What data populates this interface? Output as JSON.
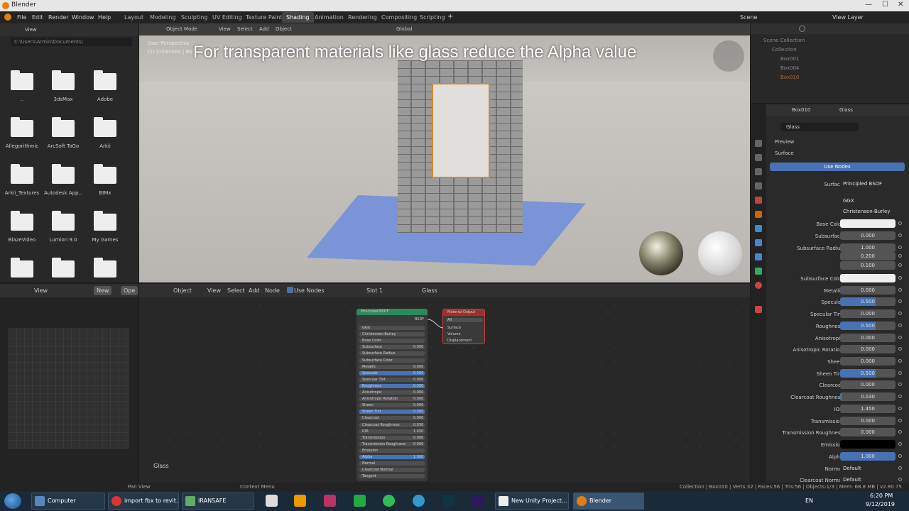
{
  "window": {
    "title": "Blender",
    "min": "—",
    "max": "☐",
    "close": "✕"
  },
  "menu": {
    "items": [
      "File",
      "Edit",
      "Render",
      "Window",
      "Help"
    ]
  },
  "workspaces": [
    "Layout",
    "Modeling",
    "Sculpting",
    "UV Editing",
    "Texture Paint",
    "Shading",
    "Animation",
    "Rendering",
    "Compositing",
    "Scripting"
  ],
  "scene": {
    "scene_label": "Scene",
    "view_layer": "View Layer"
  },
  "filebrowser": {
    "view": "View",
    "path": "C:\\Users\\Armin\\Documents\\",
    "items": [
      "..",
      "3dsMax",
      "Adobe",
      "Allegorithmic",
      "ArcSoft ToGo",
      "Arkii",
      "Arkii_Textures",
      "Autodesk App...",
      "BIMx",
      "BlazeVideo",
      "Lumion 9.0",
      "My Games",
      "",
      "",
      ""
    ]
  },
  "viewport": {
    "mode": "Object Mode",
    "view": "View",
    "select": "Select",
    "add": "Add",
    "object": "Object",
    "orientation": "Global",
    "perspective": "User Perspective",
    "collection": "(1) Collection | Bo",
    "overlay_text": "For transparent materials like glass reduce the Alpha value"
  },
  "node_editor": {
    "object": "Object",
    "view": "View",
    "select": "Select",
    "add": "Add",
    "node": "Node",
    "use_nodes": "Use Nodes",
    "slot": "Slot 1",
    "material": "Glass",
    "new": "New",
    "open": "Ope",
    "footer": "Glass",
    "principled": {
      "title": "Principled BSDF",
      "bsdf": "BSDF",
      "rows": [
        "GGX",
        "Christensen-Burley",
        "Base Color",
        "Subsurface",
        "Subsurface Radius",
        "Subsurface Color",
        "Metallic",
        "Specular",
        "Specular Tint",
        "Roughness",
        "Anisotropic",
        "Anisotropic Rotation",
        "Sheen",
        "Sheen Tint",
        "Clearcoat",
        "Clearcoat Roughness",
        "IOR",
        "Transmission",
        "Transmission Roughness",
        "Emission",
        "Alpha",
        "Normal",
        "Clearcoat Normal",
        "Tangent"
      ],
      "values": [
        "",
        "",
        "",
        "0.000",
        "",
        "",
        "0.000",
        "0.500",
        "0.000",
        "0.500",
        "0.000",
        "0.000",
        "0.000",
        "0.500",
        "0.000",
        "0.030",
        "1.450",
        "0.000",
        "0.000",
        "",
        "1.000",
        "",
        "",
        ""
      ]
    },
    "output": {
      "title": "Material Output",
      "target": "All",
      "rows": [
        "Surface",
        "Volume",
        "Displacement"
      ]
    }
  },
  "outliner": {
    "items": [
      "Scene Collection",
      "Collection",
      "Box001",
      "Box004",
      "Box010"
    ]
  },
  "properties": {
    "object": "Box010",
    "material": "Glass",
    "mat_field": "Glass",
    "preview": "Preview",
    "surface_section": "Surface",
    "use_nodes": "Use Nodes",
    "surface_label": "Surface",
    "surface_value": "Principled BSDF",
    "distribution": "GGX",
    "subsurface_method": "Christensen-Burley",
    "rows": [
      {
        "label": "Base Color",
        "value": "",
        "style": "white"
      },
      {
        "label": "Subsurface",
        "value": "0.000",
        "style": ""
      },
      {
        "label": "Subsurface Radius",
        "value": "1.000",
        "style": ""
      },
      {
        "label": "",
        "value": "0.200",
        "style": ""
      },
      {
        "label": "",
        "value": "0.100",
        "style": ""
      },
      {
        "label": "Subsurface Color",
        "value": "",
        "style": "white"
      },
      {
        "label": "Metallic",
        "value": "0.000",
        "style": ""
      },
      {
        "label": "Specular",
        "value": "0.500",
        "style": "blue"
      },
      {
        "label": "Specular Tint",
        "value": "0.000",
        "style": ""
      },
      {
        "label": "Roughness",
        "value": "0.500",
        "style": "blue"
      },
      {
        "label": "Anisotropic",
        "value": "0.000",
        "style": ""
      },
      {
        "label": "Anisotropic Rotation",
        "value": "0.000",
        "style": ""
      },
      {
        "label": "Sheen",
        "value": "0.000",
        "style": ""
      },
      {
        "label": "Sheen Tint",
        "value": "0.500",
        "style": "blue"
      },
      {
        "label": "Clearcoat",
        "value": "0.000",
        "style": ""
      },
      {
        "label": "Clearcoat Roughness",
        "value": "0.030",
        "style": "blue2"
      },
      {
        "label": "IOR",
        "value": "1.450",
        "style": ""
      },
      {
        "label": "Transmission",
        "value": "0.000",
        "style": ""
      },
      {
        "label": "Transmission Roughness",
        "value": "0.000",
        "style": ""
      },
      {
        "label": "Emission",
        "value": "",
        "style": "black"
      },
      {
        "label": "Alpha",
        "value": "1.000",
        "style": "full"
      },
      {
        "label": "Normal",
        "value": "Default",
        "style": "drop"
      },
      {
        "label": "Clearcoat Normal",
        "value": "Default",
        "style": "drop"
      }
    ]
  },
  "status": {
    "left": "Pan View",
    "mid": "Context Menu",
    "right": "Collection | Box010 | Verts:32 | Faces:56 | Tris:56 | Objects:1/3 | Mem: 68.8 MB | v2.80.75"
  },
  "taskbar": {
    "buttons": [
      "Computer",
      "import fbx to revit...",
      "IRANSAFE",
      "New Unity Project...",
      "Blender"
    ],
    "lang": "EN",
    "time": "6:20 PM",
    "date": "9/12/2019"
  },
  "colors": {
    "accent": "#4772b3",
    "blender_orange": "#e87d0d"
  }
}
